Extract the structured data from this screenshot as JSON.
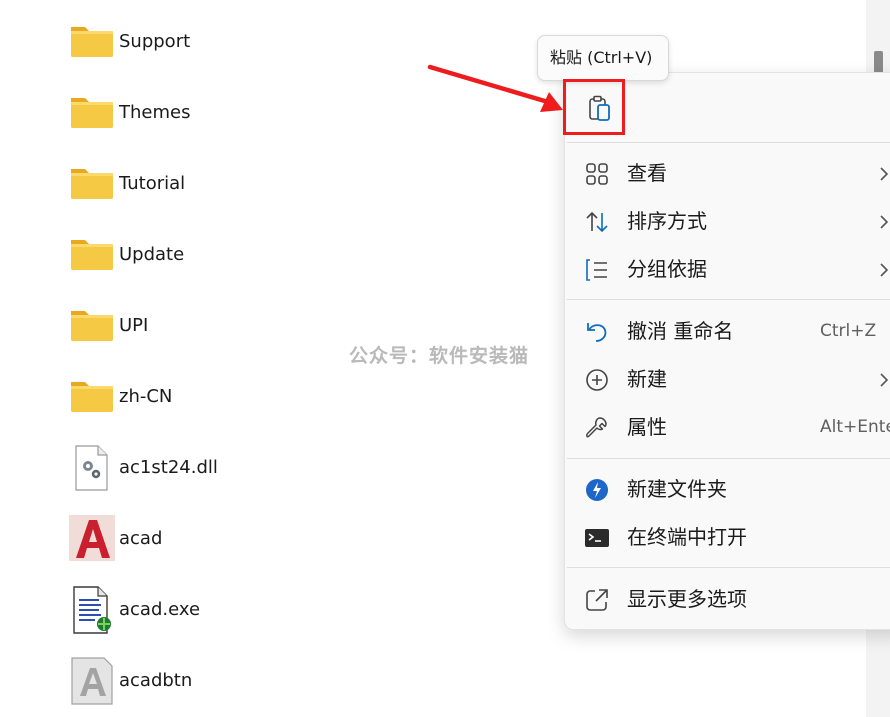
{
  "files": [
    {
      "name": "Support",
      "icon": "folder-icon"
    },
    {
      "name": "Themes",
      "icon": "folder-icon"
    },
    {
      "name": "Tutorial",
      "icon": "folder-icon"
    },
    {
      "name": "Update",
      "icon": "folder-icon"
    },
    {
      "name": "UPI",
      "icon": "folder-icon"
    },
    {
      "name": "zh-CN",
      "icon": "folder-icon"
    },
    {
      "name": "ac1st24.dll",
      "icon": "dll-file-icon"
    },
    {
      "name": "acad",
      "icon": "autocad-app-icon"
    },
    {
      "name": "acad.exe",
      "icon": "exe-file-icon"
    },
    {
      "name": "acadbtn",
      "icon": "autocad-gray-file-icon"
    }
  ],
  "tooltip": {
    "text": "粘贴 (Ctrl+V)"
  },
  "watermark": "公众号：软件安装猫",
  "context_menu": {
    "top_actions": [
      {
        "icon": "paste-icon",
        "tooltip": "粘贴 (Ctrl+V)"
      }
    ],
    "items": [
      {
        "label": "查看",
        "icon": "grid-view-icon",
        "submenu": true
      },
      {
        "label": "排序方式",
        "icon": "sort-arrows-icon",
        "submenu": true
      },
      {
        "label": "分组依据",
        "icon": "group-list-icon",
        "submenu": true
      },
      {
        "label": "撤消 重命名",
        "icon": "undo-icon",
        "shortcut": "Ctrl+Z"
      },
      {
        "label": "新建",
        "icon": "plus-circle-icon",
        "submenu": true
      },
      {
        "label": "属性",
        "icon": "wrench-icon",
        "shortcut": "Alt+Ente"
      },
      {
        "label": "新建文件夹",
        "icon": "power-toys-icon"
      },
      {
        "label": "在终端中打开",
        "icon": "terminal-icon"
      },
      {
        "label": "显示更多选项",
        "icon": "share-external-icon"
      }
    ]
  },
  "annotation": {
    "highlight_color": "#ee1c1c",
    "target": "paste-button"
  },
  "colors": {
    "folder": "#f6c945",
    "accent": "#0f6cbd",
    "menu_bg": "#f9f9f9"
  }
}
